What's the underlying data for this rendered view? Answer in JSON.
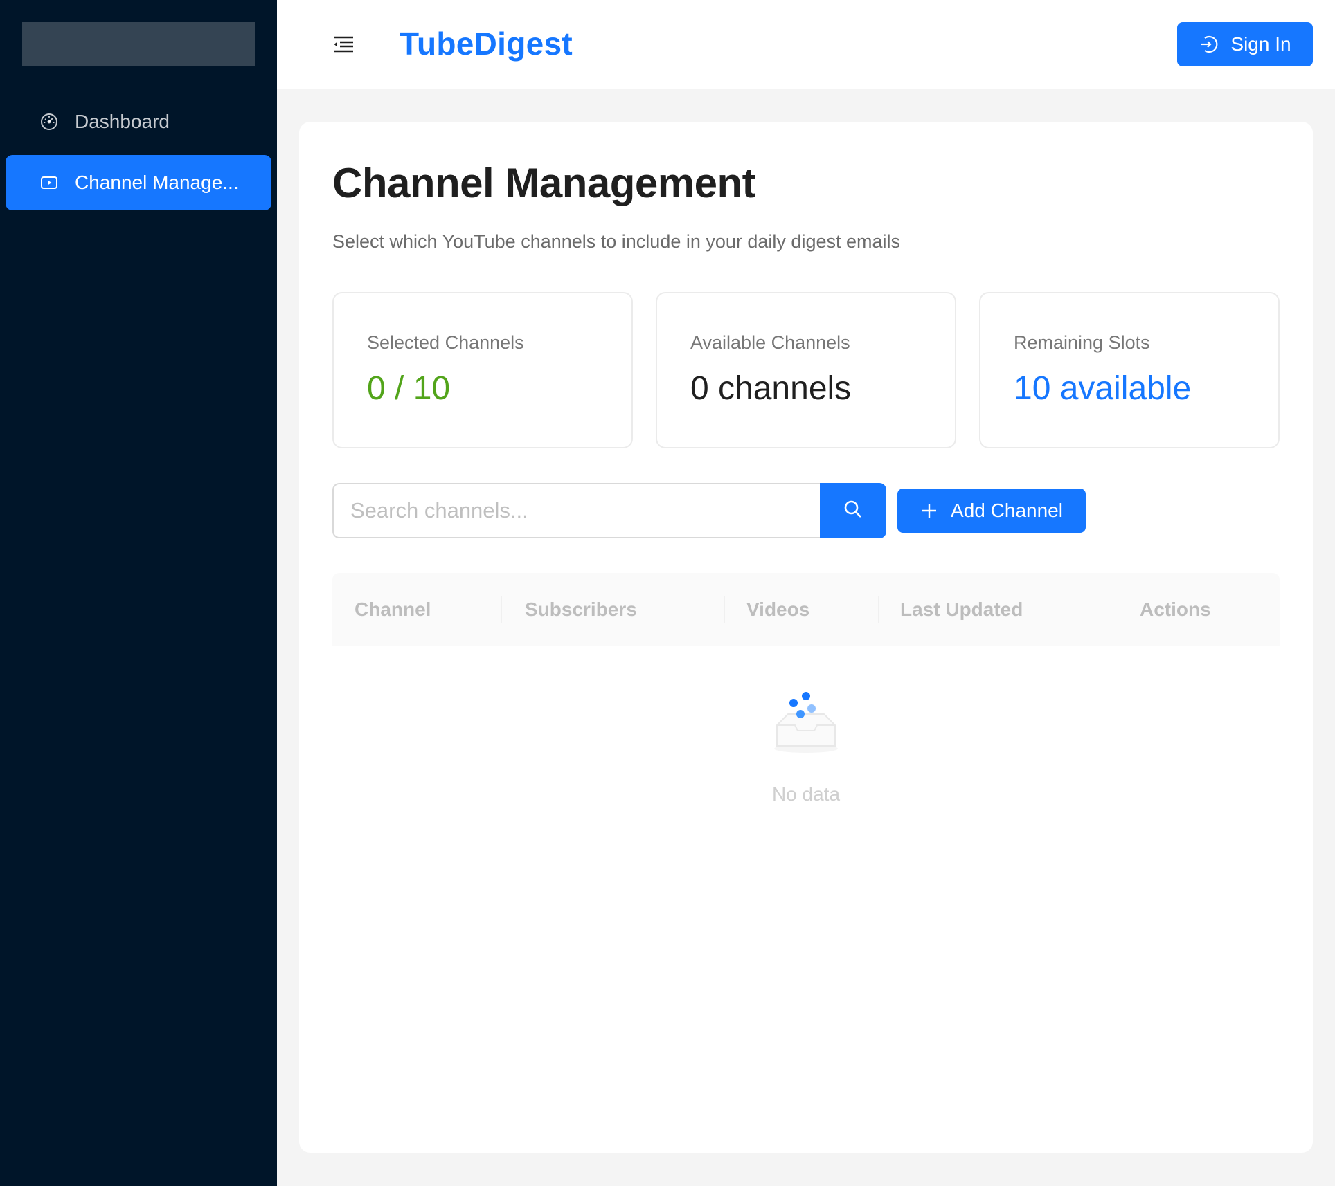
{
  "sidebar": {
    "items": [
      {
        "label": "Dashboard",
        "icon": "dashboard-icon",
        "active": false
      },
      {
        "label": "Channel Manage...",
        "icon": "video-icon",
        "active": true
      }
    ]
  },
  "header": {
    "brand": "TubeDigest",
    "signin_label": "Sign In",
    "accent_color": "#1677ff"
  },
  "main": {
    "title": "Channel Management",
    "subtitle": "Select which YouTube channels to include in your daily digest emails",
    "stats": [
      {
        "label": "Selected Channels",
        "value": "0 / 10",
        "color": "#52a41a"
      },
      {
        "label": "Available Channels",
        "value": "0 channels",
        "color": "#1f1f1f"
      },
      {
        "label": "Remaining Slots",
        "value": "10 available",
        "color": "#1677ff"
      }
    ],
    "search": {
      "placeholder": "Search channels..."
    },
    "add_button_label": "Add Channel",
    "table": {
      "columns": [
        "Channel",
        "Subscribers",
        "Videos",
        "Last Updated",
        "Actions"
      ],
      "rows": [],
      "empty_text": "No data"
    }
  }
}
